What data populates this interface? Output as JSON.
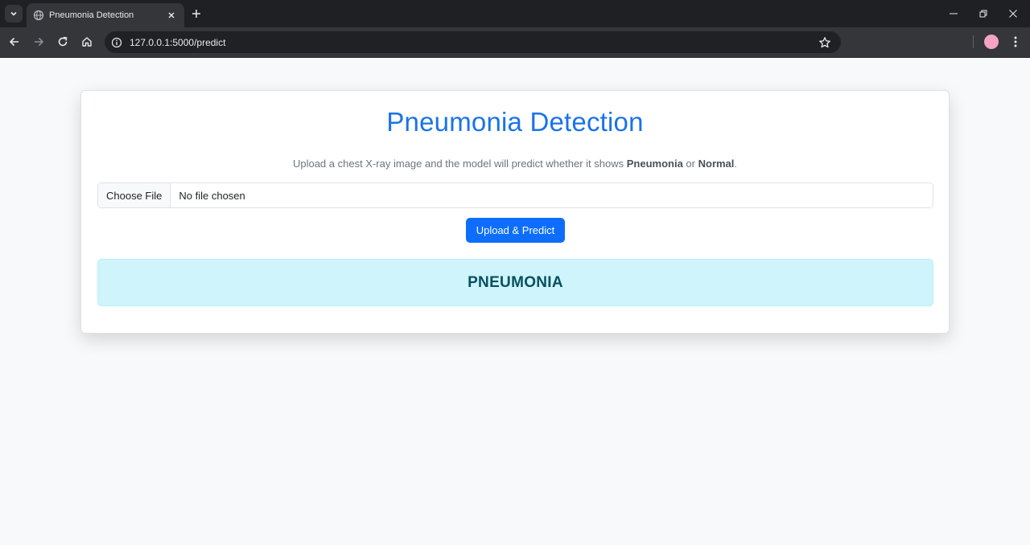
{
  "browser": {
    "tab_title": "Pneumonia Detection",
    "url": "127.0.0.1:5000/predict",
    "icons": [
      "tab-search-icon",
      "globe-icon",
      "close-icon",
      "plus-icon",
      "minimize-icon",
      "restore-icon",
      "back-icon",
      "forward-icon",
      "reload-icon",
      "home-icon",
      "info-icon",
      "star-icon",
      "kebab-menu-icon"
    ],
    "colors": {
      "tabstrip": "#1f2023",
      "toolbar": "#35363a",
      "omnibox": "#202124",
      "profile": "#f4a3c2"
    }
  },
  "page": {
    "title": "Pneumonia Detection",
    "description_prefix": "Upload a chest X-ray image and the model will predict whether it shows ",
    "description_bold_1": "Pneumonia",
    "description_middle": " or ",
    "description_bold_2": "Normal",
    "description_suffix": ".",
    "file_button": "Choose File",
    "file_status": "No file chosen",
    "submit_label": "Upload & Predict",
    "result": "PNEUMONIA",
    "colors": {
      "title": "#1a73e8",
      "button": "#0d6efd",
      "result_bg": "#cff4fc",
      "result_text": "#055160"
    }
  }
}
